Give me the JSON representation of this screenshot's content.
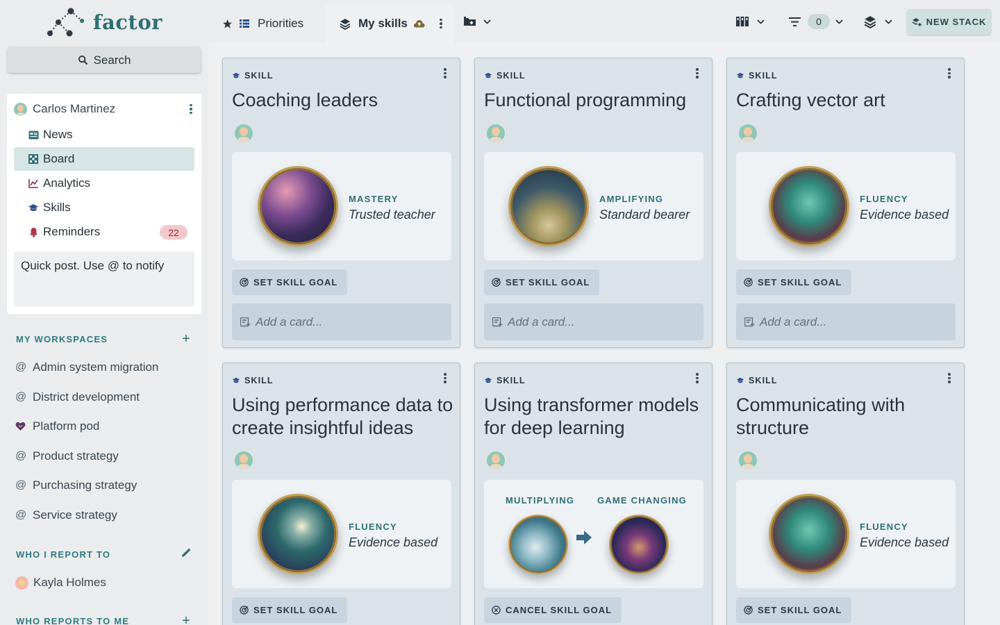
{
  "app": {
    "logo_text": "factor"
  },
  "sidebar": {
    "search_label": "Search",
    "user": {
      "name": "Carlos Martinez"
    },
    "nav": [
      {
        "label": "News",
        "icon": "news-icon"
      },
      {
        "label": "Board",
        "icon": "board-icon",
        "active": true
      },
      {
        "label": "Analytics",
        "icon": "analytics-icon"
      },
      {
        "label": "Skills",
        "icon": "skills-icon"
      },
      {
        "label": "Reminders",
        "icon": "bell-icon",
        "badge": "22"
      }
    ],
    "quick_post_placeholder": "Quick post. Use @ to notify",
    "workspaces_heading": "MY WORKSPACES",
    "workspaces": [
      {
        "label": "Admin system migration",
        "icon": "at-icon"
      },
      {
        "label": "District development",
        "icon": "at-icon"
      },
      {
        "label": "Platform pod",
        "icon": "heart-icon"
      },
      {
        "label": "Product strategy",
        "icon": "at-icon"
      },
      {
        "label": "Purchasing strategy",
        "icon": "at-icon"
      },
      {
        "label": "Service strategy",
        "icon": "at-icon"
      }
    ],
    "report_to_heading": "WHO I REPORT TO",
    "report_to": [
      {
        "label": "Kayla Holmes"
      }
    ],
    "reports_heading": "WHO REPORTS TO ME"
  },
  "topbar": {
    "tabs": [
      {
        "label": "Priorities",
        "active": false
      },
      {
        "label": "My skills",
        "active": true
      }
    ],
    "filter_count": "0",
    "new_stack_label": "NEW STACK"
  },
  "board": {
    "cards": [
      {
        "type": "SKILL",
        "title": "Coaching leaders",
        "levels": [
          {
            "name": "MASTERY",
            "desc": "Trusted teacher"
          }
        ],
        "goal_label": "SET SKILL GOAL",
        "add_card_placeholder": "Add a card..."
      },
      {
        "type": "SKILL",
        "title": "Functional programming",
        "levels": [
          {
            "name": "AMPLIFYING",
            "desc": "Standard bearer"
          }
        ],
        "goal_label": "SET SKILL GOAL",
        "add_card_placeholder": "Add a card..."
      },
      {
        "type": "SKILL",
        "title": "Crafting vector art",
        "levels": [
          {
            "name": "FLUENCY",
            "desc": "Evidence based"
          }
        ],
        "goal_label": "SET SKILL GOAL",
        "add_card_placeholder": "Add a card..."
      },
      {
        "type": "SKILL",
        "title": "Using performance data to create insightful ideas",
        "levels": [
          {
            "name": "FLUENCY",
            "desc": "Evidence based"
          }
        ],
        "goal_label": "SET SKILL GOAL"
      },
      {
        "type": "SKILL",
        "title": "Using transformer models for deep learning",
        "levels": [
          {
            "name": "MULTIPLYING"
          },
          {
            "name": "GAME CHANGING"
          }
        ],
        "goal_label": "CANCEL SKILL GOAL"
      },
      {
        "type": "SKILL",
        "title": "Communicating with structure",
        "levels": [
          {
            "name": "FLUENCY",
            "desc": "Evidence based"
          }
        ],
        "goal_label": "SET SKILL GOAL"
      }
    ]
  },
  "colors": {
    "accent": "#2f6f73",
    "card_bg": "#dbe3e9",
    "badge_bg": "#f2c8cc",
    "badge_text": "#8e2d3a"
  }
}
